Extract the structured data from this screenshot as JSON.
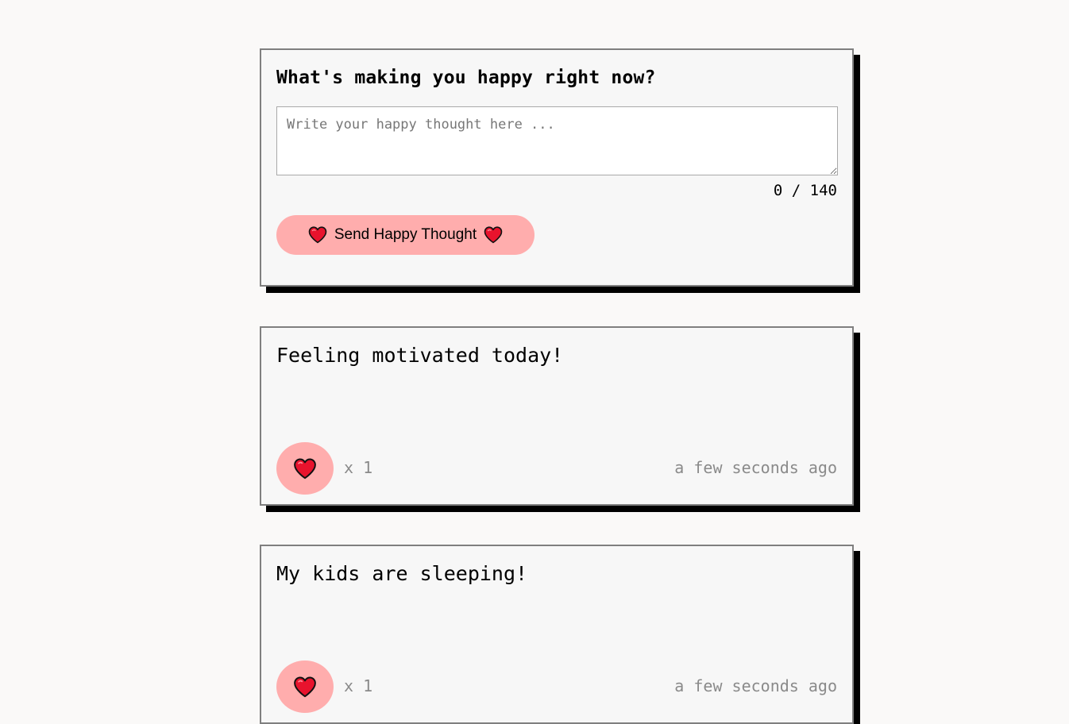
{
  "form": {
    "title": "What's making you happy right now?",
    "input_value": "",
    "input_placeholder": "Write your happy thought here ...",
    "counter": "0 / 140",
    "send_label": "Send Happy Thought",
    "icon": "heart-icon"
  },
  "thoughts": [
    {
      "message": "Feeling motivated today!",
      "likes": "x 1",
      "time": "a few seconds ago"
    },
    {
      "message": "My kids are sleeping!",
      "likes": "x 1",
      "time": "a few seconds ago"
    }
  ],
  "colors": {
    "background": "#faf9f8",
    "card": "#f7f7f7",
    "accent_pink": "#ffadad",
    "heart_red": "#e8132d",
    "shadow": "#000000",
    "muted_text": "#8a8a8a"
  }
}
